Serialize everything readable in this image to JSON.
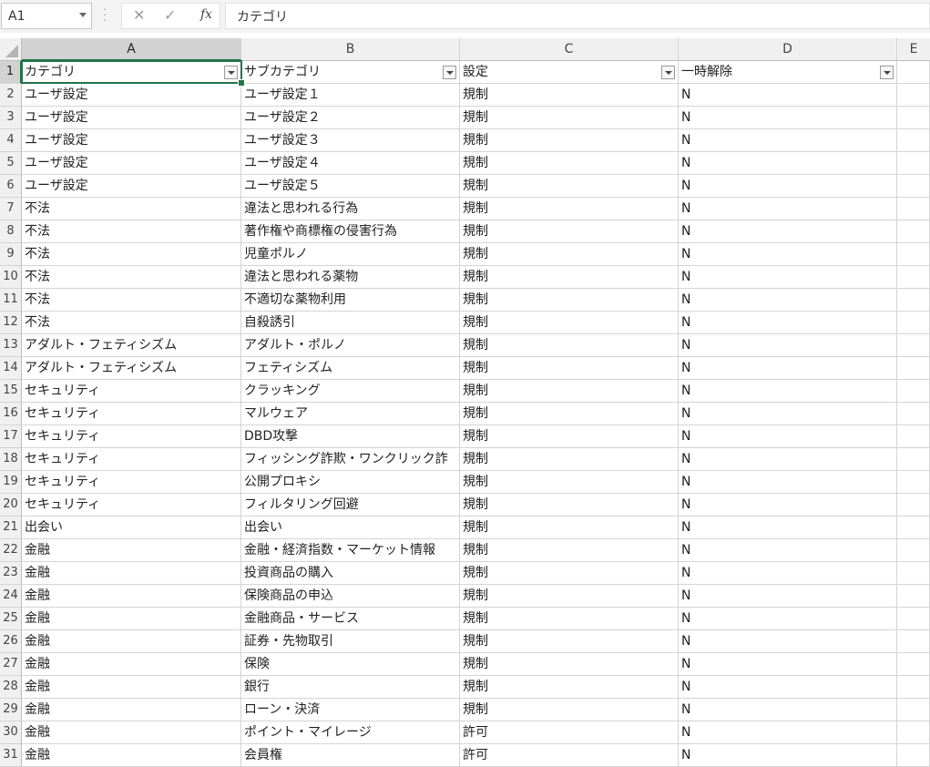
{
  "formula_bar": {
    "name_box": "A1",
    "cancel_icon": "✕",
    "enter_icon": "✓",
    "fx_label": "fx",
    "formula_value": "カテゴリ"
  },
  "columns": [
    "A",
    "B",
    "C",
    "D",
    "E"
  ],
  "header_row": {
    "row": "1",
    "a": "カテゴリ",
    "b": "サブカテゴリ",
    "c": "設定",
    "d": "一時解除"
  },
  "rows": [
    {
      "row": "2",
      "a": "ユーザ設定",
      "b": "ユーザ設定１",
      "c": "規制",
      "d": "N"
    },
    {
      "row": "3",
      "a": "ユーザ設定",
      "b": "ユーザ設定２",
      "c": "規制",
      "d": "N"
    },
    {
      "row": "4",
      "a": "ユーザ設定",
      "b": "ユーザ設定３",
      "c": "規制",
      "d": "N"
    },
    {
      "row": "5",
      "a": "ユーザ設定",
      "b": "ユーザ設定４",
      "c": "規制",
      "d": "N"
    },
    {
      "row": "6",
      "a": "ユーザ設定",
      "b": "ユーザ設定５",
      "c": "規制",
      "d": "N"
    },
    {
      "row": "7",
      "a": "不法",
      "b": "違法と思われる行為",
      "c": "規制",
      "d": "N"
    },
    {
      "row": "8",
      "a": "不法",
      "b": "著作権や商標権の侵害行為",
      "c": "規制",
      "d": "N"
    },
    {
      "row": "9",
      "a": "不法",
      "b": "児童ポルノ",
      "c": "規制",
      "d": "N"
    },
    {
      "row": "10",
      "a": "不法",
      "b": "違法と思われる薬物",
      "c": "規制",
      "d": "N"
    },
    {
      "row": "11",
      "a": "不法",
      "b": "不適切な薬物利用",
      "c": "規制",
      "d": "N"
    },
    {
      "row": "12",
      "a": "不法",
      "b": "自殺誘引",
      "c": "規制",
      "d": "N"
    },
    {
      "row": "13",
      "a": "アダルト・フェティシズム",
      "b": "アダルト・ポルノ",
      "c": "規制",
      "d": "N"
    },
    {
      "row": "14",
      "a": "アダルト・フェティシズム",
      "b": "フェティシズム",
      "c": "規制",
      "d": "N"
    },
    {
      "row": "15",
      "a": "セキュリティ",
      "b": "クラッキング",
      "c": "規制",
      "d": "N"
    },
    {
      "row": "16",
      "a": "セキュリティ",
      "b": "マルウェア",
      "c": "規制",
      "d": "N"
    },
    {
      "row": "17",
      "a": "セキュリティ",
      "b": "DBD攻撃",
      "c": "規制",
      "d": "N"
    },
    {
      "row": "18",
      "a": "セキュリティ",
      "b": "フィッシング詐欺・ワンクリック詐",
      "c": "規制",
      "d": "N"
    },
    {
      "row": "19",
      "a": "セキュリティ",
      "b": "公開プロキシ",
      "c": "規制",
      "d": "N"
    },
    {
      "row": "20",
      "a": "セキュリティ",
      "b": "フィルタリング回避",
      "c": "規制",
      "d": "N"
    },
    {
      "row": "21",
      "a": "出会い",
      "b": "出会い",
      "c": "規制",
      "d": "N"
    },
    {
      "row": "22",
      "a": "金融",
      "b": "金融・経済指数・マーケット情報",
      "c": "規制",
      "d": "N"
    },
    {
      "row": "23",
      "a": "金融",
      "b": "投資商品の購入",
      "c": "規制",
      "d": "N"
    },
    {
      "row": "24",
      "a": "金融",
      "b": "保険商品の申込",
      "c": "規制",
      "d": "N"
    },
    {
      "row": "25",
      "a": "金融",
      "b": "金融商品・サービス",
      "c": "規制",
      "d": "N"
    },
    {
      "row": "26",
      "a": "金融",
      "b": "証券・先物取引",
      "c": "規制",
      "d": "N"
    },
    {
      "row": "27",
      "a": "金融",
      "b": "保険",
      "c": "規制",
      "d": "N"
    },
    {
      "row": "28",
      "a": "金融",
      "b": "銀行",
      "c": "規制",
      "d": "N"
    },
    {
      "row": "29",
      "a": "金融",
      "b": "ローン・決済",
      "c": "規制",
      "d": "N"
    },
    {
      "row": "30",
      "a": "金融",
      "b": "ポイント・マイレージ",
      "c": "許可",
      "d": "N"
    },
    {
      "row": "31",
      "a": "金融",
      "b": "会員権",
      "c": "許可",
      "d": "N"
    }
  ],
  "colors": {
    "accent": "#217346",
    "header_bg": "#f0f0f0",
    "selected_header_bg": "#d2d2d2"
  }
}
